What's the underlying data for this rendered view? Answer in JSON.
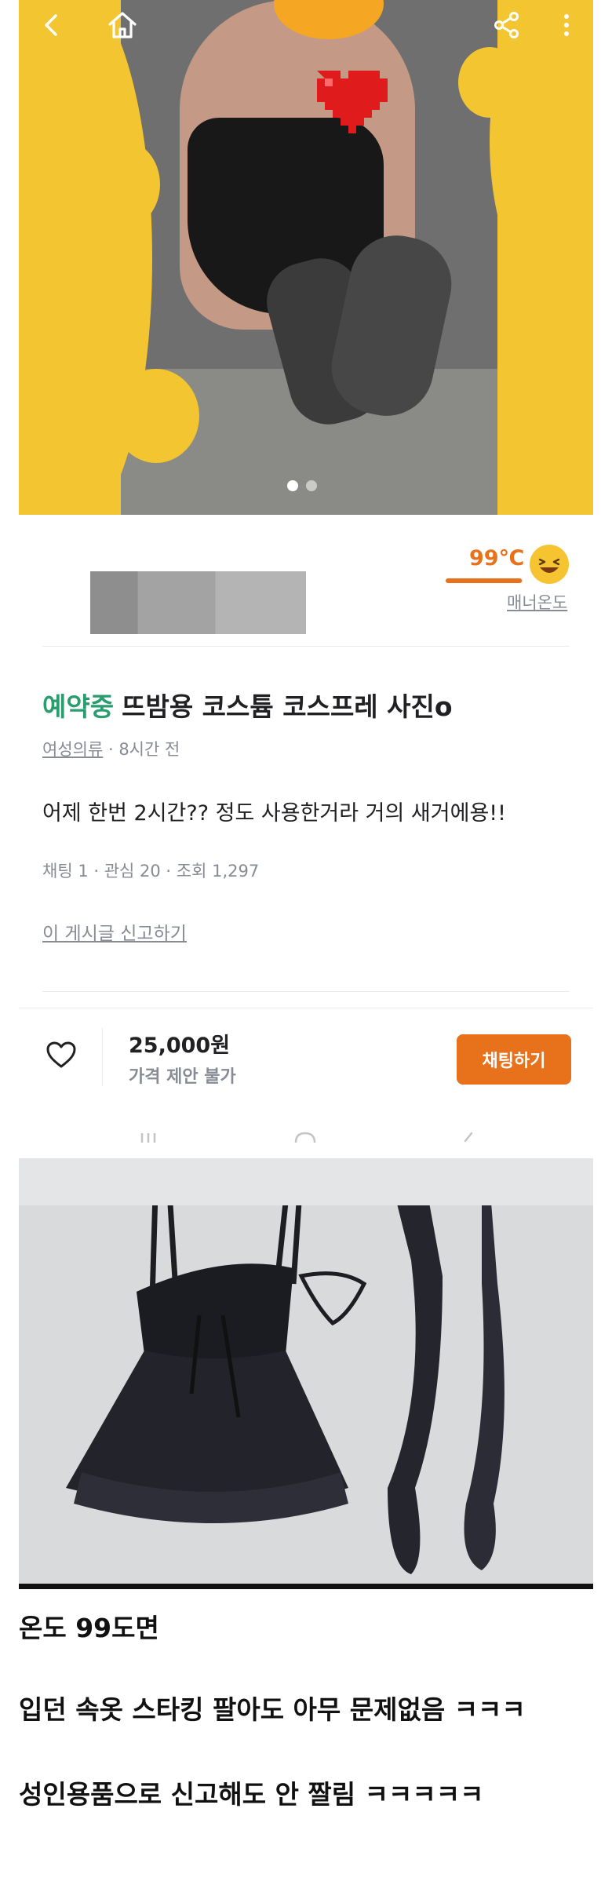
{
  "hero": {
    "image_count": 2,
    "active_index": 0
  },
  "icons": {
    "back": "back-arrow-icon",
    "home": "home-icon",
    "share": "share-icon",
    "more": "more-vertical-icon",
    "like": "heart-outline-icon",
    "temp_face": "grinning-face-icon"
  },
  "seller": {
    "temperature": "99℃",
    "temperature_level": 0.99,
    "manner_label": "매너온도"
  },
  "post": {
    "status": "예약중",
    "title": "뜨밤용 코스튬 코스프레 사진o",
    "category": "여성의류",
    "time": "· 8시간 전",
    "content": "어제 한번 2시간?? 정도 사용한거라 거의 새거에용!!",
    "stats": "채팅 1 · 관심 20 · 조회 1,297",
    "report_link": "이 게시글 신고하기"
  },
  "price_bar": {
    "price": "25,000원",
    "price_note": "가격 제안 불가",
    "chat_button": "채팅하기"
  },
  "caption": {
    "line1": "온도 99도면",
    "line2": "입던 속옷  스타킹 팔아도 아무 문제없음 ㅋㅋㅋ",
    "line3": "성인용품으로 신고해도 안 짤림 ㅋㅋㅋㅋㅋ"
  },
  "colors": {
    "accent": "#e8711c",
    "status_green": "#2a9d6f",
    "muted": "#868b94",
    "hero_cover": "#f2c531"
  }
}
